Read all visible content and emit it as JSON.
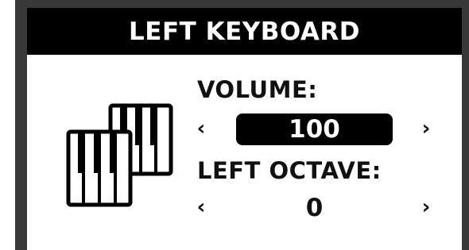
{
  "title": "LEFT KEYBOARD",
  "icon": "piano-keys-icon",
  "volume": {
    "label": "VOLUME:",
    "value": "100",
    "left_arrow": "‹",
    "right_arrow": "›"
  },
  "left_octave": {
    "label": "LEFT OCTAVE:",
    "value": "0",
    "left_arrow": "‹",
    "right_arrow": "›"
  },
  "colors": {
    "frame": "#383838",
    "highlight": "#000000",
    "text": "#111111"
  }
}
